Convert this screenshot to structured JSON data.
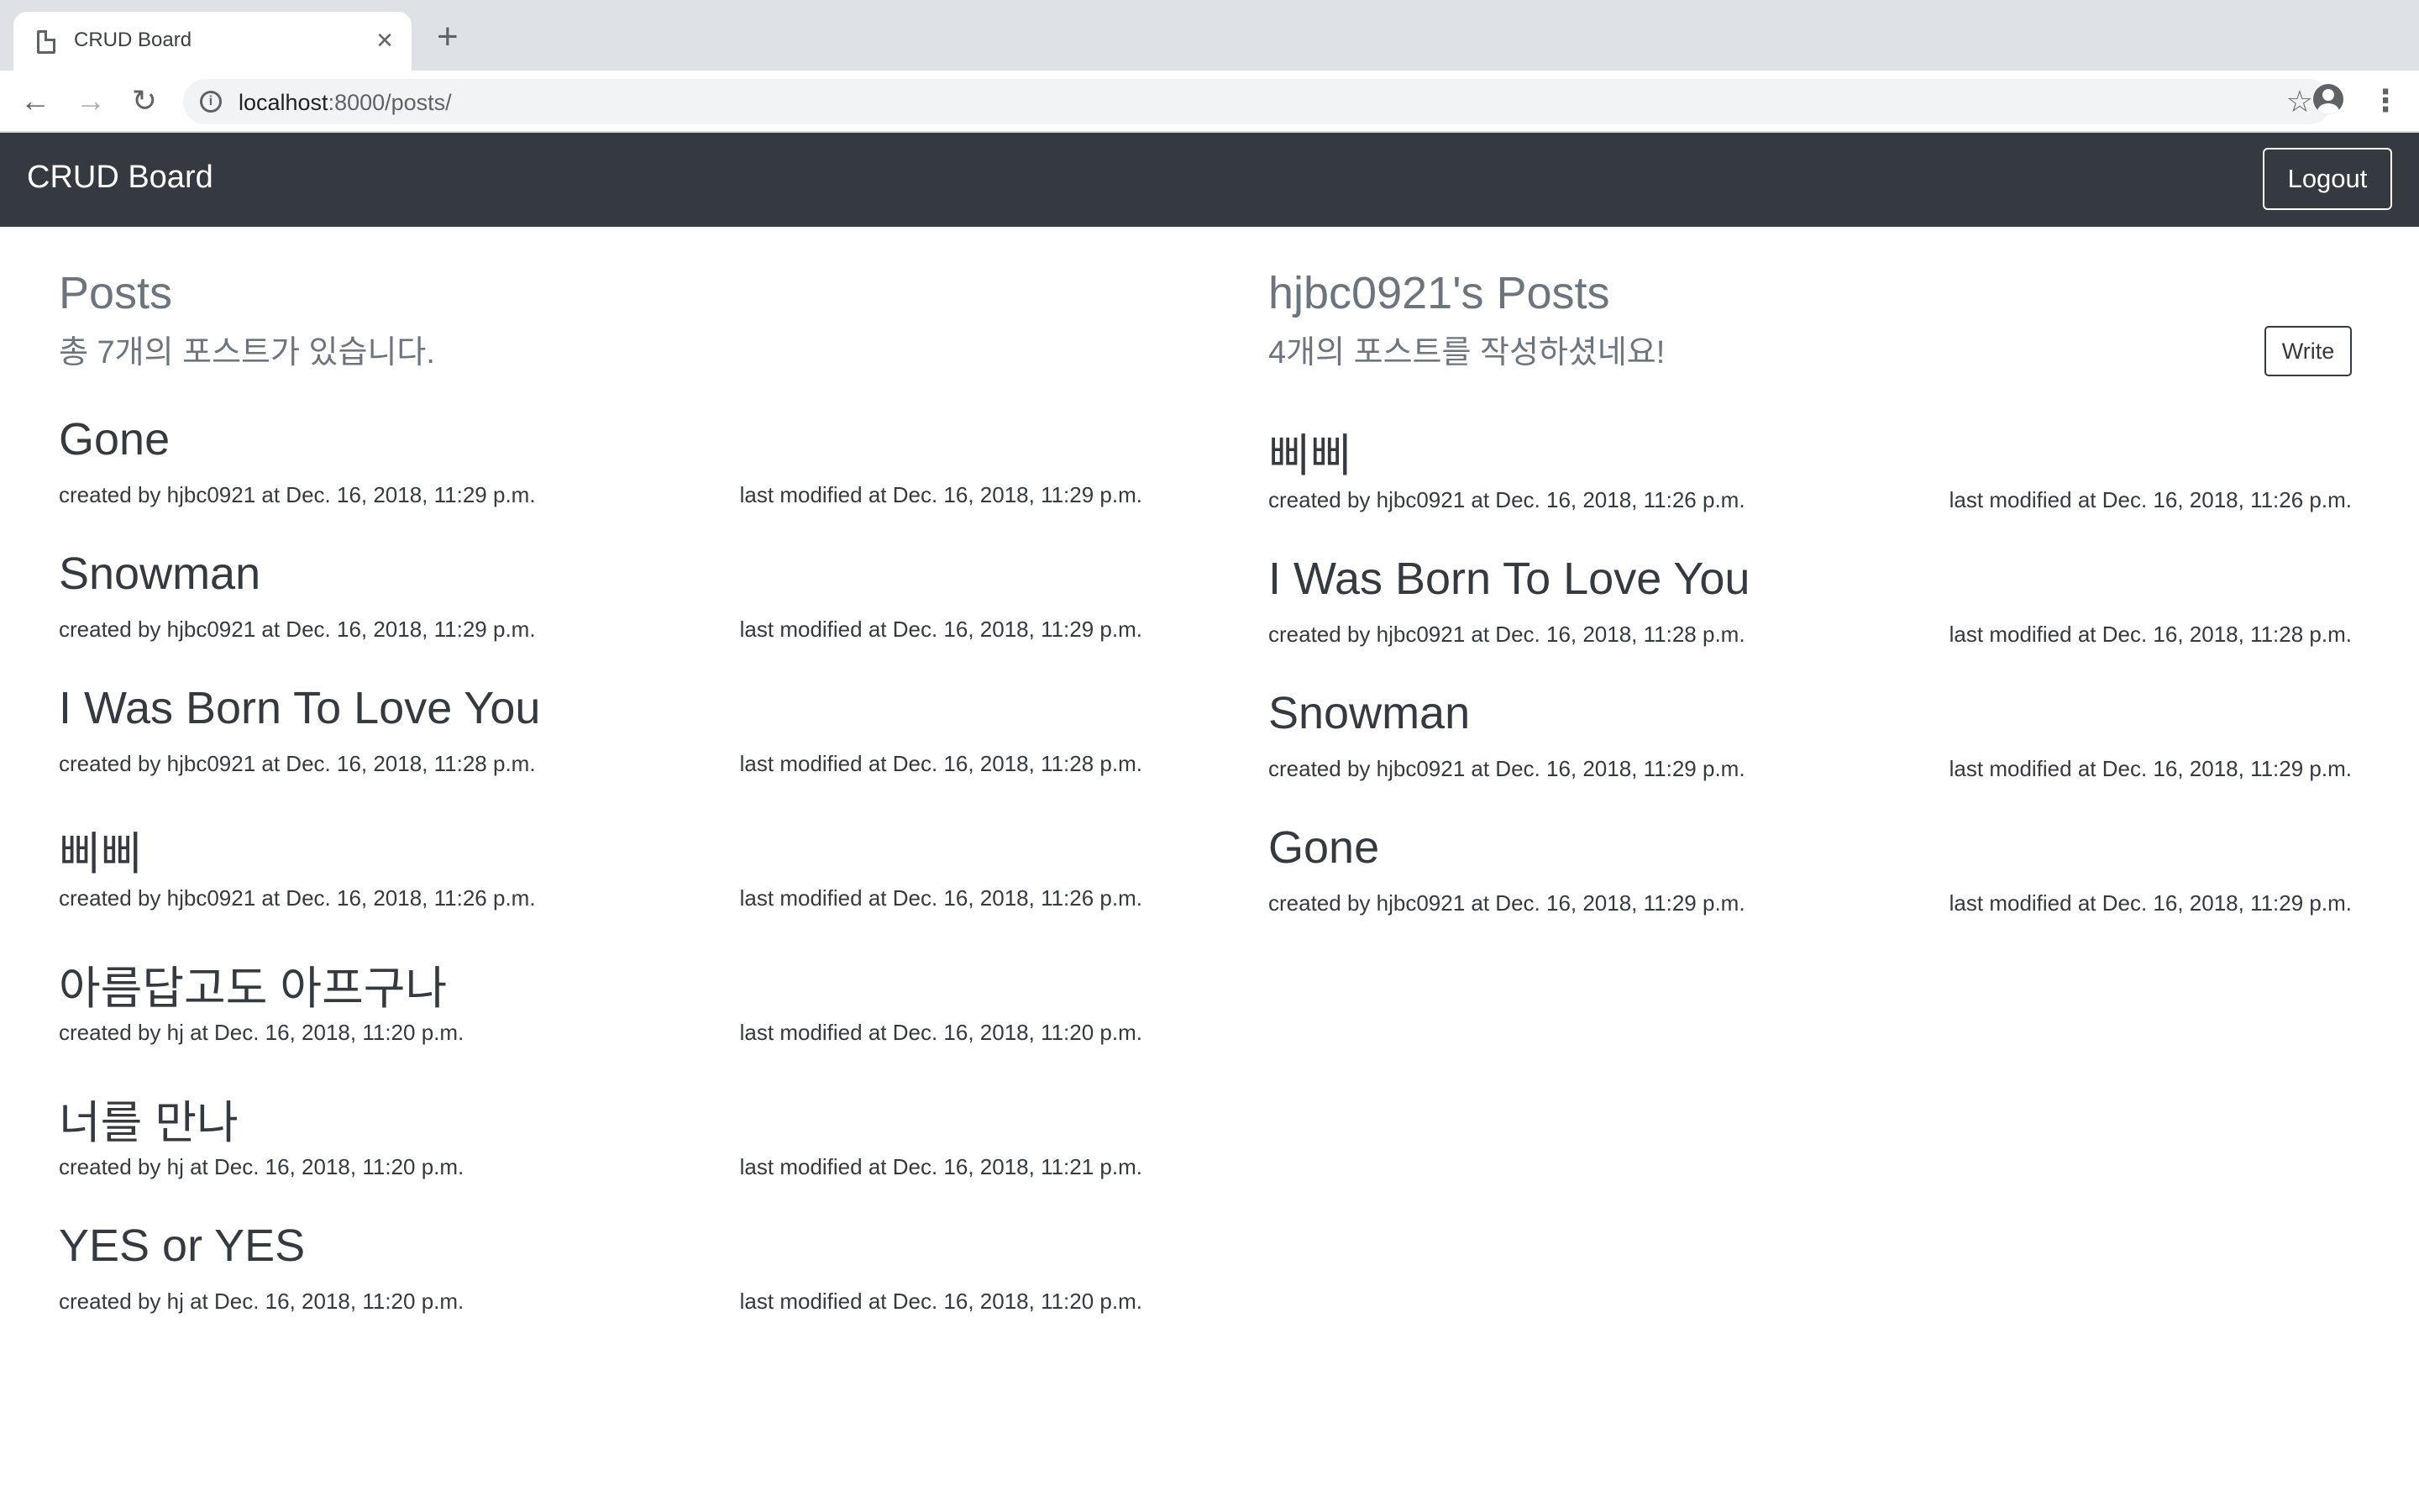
{
  "browser": {
    "tab_title": "CRUD Board",
    "tab_close": "×",
    "new_tab": "+",
    "back": "←",
    "forward": "→",
    "reload": "↻",
    "url_host": "localhost",
    "url_rest": ":8000/posts/",
    "info": "i",
    "star": "☆",
    "menu": "⋮"
  },
  "navbar": {
    "brand": "CRUD Board",
    "logout_label": "Logout"
  },
  "all_posts": {
    "title": "Posts",
    "subtitle": "총 7개의 포스트가 있습니다.",
    "items": [
      {
        "title": "Gone",
        "created": "created by hjbc0921 at Dec. 16, 2018, 11:29 p.m.",
        "modified": "last modified at Dec. 16, 2018, 11:29 p.m."
      },
      {
        "title": "Snowman",
        "created": "created by hjbc0921 at Dec. 16, 2018, 11:29 p.m.",
        "modified": "last modified at Dec. 16, 2018, 11:29 p.m."
      },
      {
        "title": "I Was Born To Love You",
        "created": "created by hjbc0921 at Dec. 16, 2018, 11:28 p.m.",
        "modified": "last modified at Dec. 16, 2018, 11:28 p.m."
      },
      {
        "title": "삐삐",
        "created": "created by hjbc0921 at Dec. 16, 2018, 11:26 p.m.",
        "modified": "last modified at Dec. 16, 2018, 11:26 p.m."
      },
      {
        "title": "아름답고도 아프구나",
        "created": "created by hj at Dec. 16, 2018, 11:20 p.m.",
        "modified": "last modified at Dec. 16, 2018, 11:20 p.m."
      },
      {
        "title": "너를 만나",
        "created": "created by hj at Dec. 16, 2018, 11:20 p.m.",
        "modified": "last modified at Dec. 16, 2018, 11:21 p.m."
      },
      {
        "title": "YES or YES",
        "created": "created by hj at Dec. 16, 2018, 11:20 p.m.",
        "modified": "last modified at Dec. 16, 2018, 11:20 p.m."
      }
    ]
  },
  "my_posts": {
    "title": "hjbc0921's Posts",
    "subtitle": "4개의 포스트를 작성하셨네요!",
    "write_label": "Write",
    "items": [
      {
        "title": "삐삐",
        "created": "created by hjbc0921 at Dec. 16, 2018, 11:26 p.m.",
        "modified": "last modified at Dec. 16, 2018, 11:26 p.m."
      },
      {
        "title": "I Was Born To Love You",
        "created": "created by hjbc0921 at Dec. 16, 2018, 11:28 p.m.",
        "modified": "last modified at Dec. 16, 2018, 11:28 p.m."
      },
      {
        "title": "Snowman",
        "created": "created by hjbc0921 at Dec. 16, 2018, 11:29 p.m.",
        "modified": "last modified at Dec. 16, 2018, 11:29 p.m."
      },
      {
        "title": "Gone",
        "created": "created by hjbc0921 at Dec. 16, 2018, 11:29 p.m.",
        "modified": "last modified at Dec. 16, 2018, 11:29 p.m."
      }
    ]
  }
}
